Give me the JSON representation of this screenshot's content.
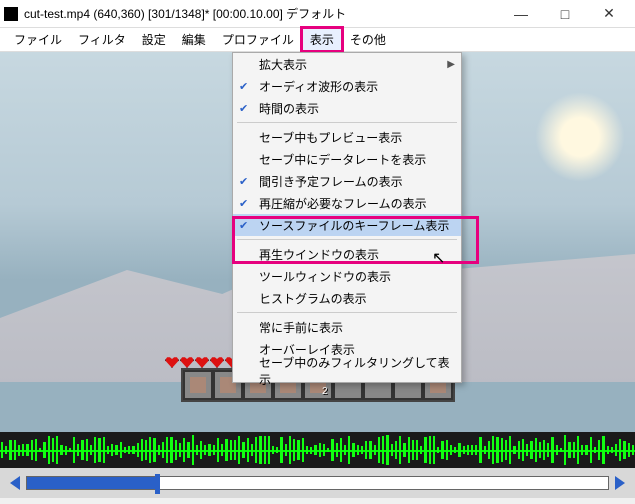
{
  "title": "cut-test.mp4 (640,360) [301/1348]* [00:00.10.00] デフォルト",
  "window_controls": {
    "min": "—",
    "max": "□",
    "close": "✕"
  },
  "menubar": [
    "ファイル",
    "フィルタ",
    "設定",
    "編集",
    "プロファイル",
    "表示",
    "その他"
  ],
  "highlighted_menu_index": 5,
  "dropdown": {
    "items": [
      {
        "label": "拡大表示",
        "checked": false,
        "arrow": true
      },
      {
        "label": "オーディオ波形の表示",
        "checked": true
      },
      {
        "label": "時間の表示",
        "checked": true
      },
      {
        "sep": true
      },
      {
        "label": "セーブ中もプレビュー表示",
        "checked": false
      },
      {
        "label": "セーブ中にデータレートを表示",
        "checked": false
      },
      {
        "label": "間引き予定フレームの表示",
        "checked": true
      },
      {
        "label": "再圧縮が必要なフレームの表示",
        "checked": true
      },
      {
        "label": "ソースファイルのキーフレーム表示",
        "checked": true,
        "selected": true
      },
      {
        "sep": true
      },
      {
        "label": "再生ウインドウの表示",
        "checked": false
      },
      {
        "label": "ツールウィンドウの表示",
        "checked": false
      },
      {
        "label": "ヒストグラムの表示",
        "checked": false
      },
      {
        "sep": true
      },
      {
        "label": "常に手前に表示",
        "checked": false
      },
      {
        "label": "オーバーレイ表示",
        "checked": false
      },
      {
        "label": "セーブ中のみフィルタリングして表示",
        "checked": false
      }
    ]
  },
  "hotbar": {
    "slots": [
      {
        "icon": "sword"
      },
      {
        "icon": "pickaxe"
      },
      {
        "icon": "axe"
      },
      {
        "icon": "shovel"
      },
      {
        "icon": "bread",
        "count": "2"
      },
      {
        "icon": ""
      },
      {
        "icon": ""
      },
      {
        "icon": ""
      },
      {
        "icon": "meat"
      }
    ]
  },
  "hearts_count": 10,
  "timeline": {
    "progress_pct": 22
  }
}
